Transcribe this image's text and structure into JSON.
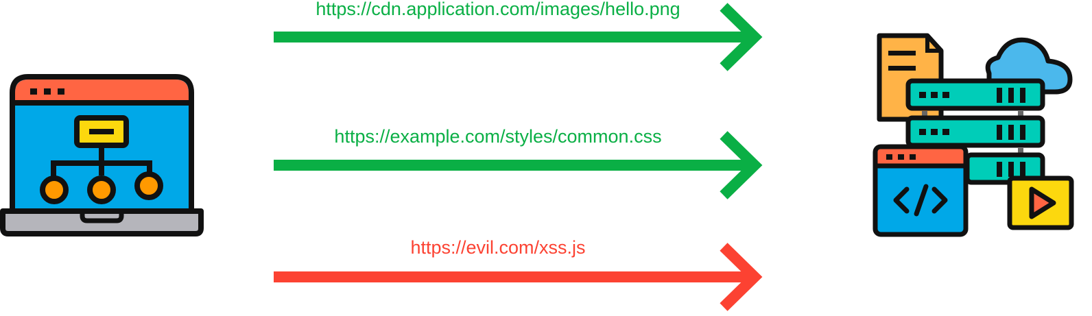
{
  "flows": [
    {
      "url": "https://cdn.application.com/images/hello.png",
      "status": "allowed",
      "color": "#0aaf45"
    },
    {
      "url": "https://example.com/styles/common.css",
      "status": "allowed",
      "color": "#0aaf45"
    },
    {
      "url": "https://evil.com/xss.js",
      "status": "blocked",
      "color": "#fc4232"
    }
  ],
  "icons": {
    "client": "laptop-sitemap-icon",
    "server": "server-cloud-code-media-icon"
  },
  "colors": {
    "outline": "#111111",
    "screen": "#00a8e8",
    "titlebar": "#ff6543",
    "accent_yellow": "#fcd80e",
    "node_orange": "#ff9900",
    "server_teal": "#00cdb8",
    "document": "#ffb347",
    "cloud": "#4bb8ec",
    "laptop_base": "#b5b5bb"
  }
}
